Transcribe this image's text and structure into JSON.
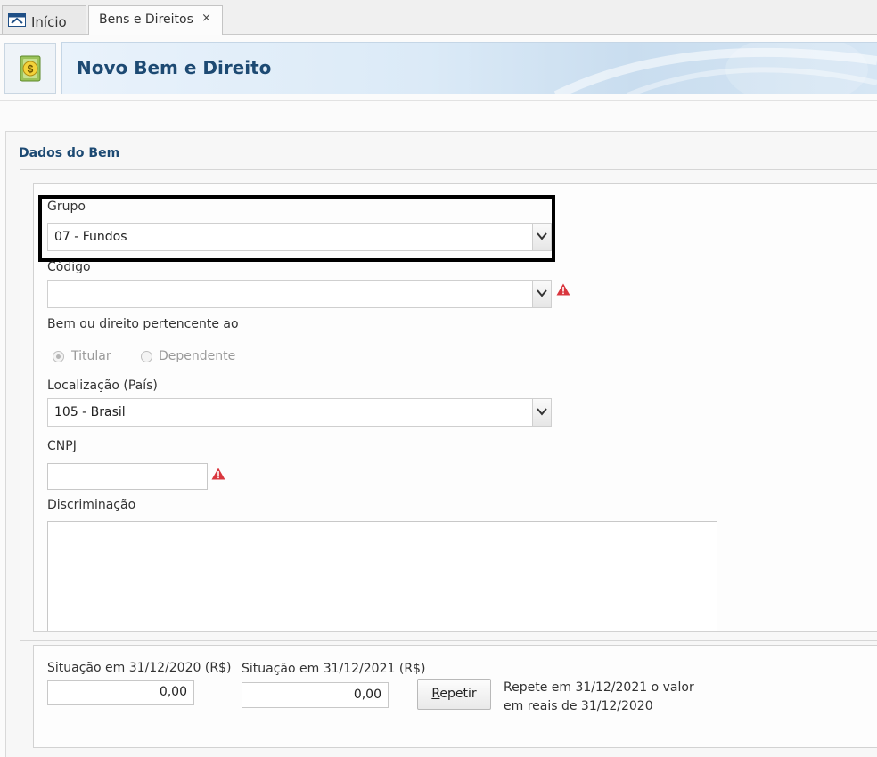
{
  "tabs": [
    {
      "label": "Início"
    },
    {
      "label": "Bens e Direitos",
      "close": "×"
    }
  ],
  "header": {
    "title": "Novo Bem e Direito"
  },
  "section": {
    "title": "Dados do Bem"
  },
  "form": {
    "grupo": {
      "label": "Grupo",
      "value": "07 - Fundos"
    },
    "codigo": {
      "label": "Código",
      "value": ""
    },
    "pertencente": {
      "label": "Bem ou direito pertencente ao",
      "options": [
        "Titular",
        "Dependente"
      ],
      "selected": "Titular"
    },
    "localizacao": {
      "label": "Localização (País)",
      "value": "105 - Brasil"
    },
    "cnpj": {
      "label": "CNPJ",
      "value": ""
    },
    "discriminacao": {
      "label": "Discriminação",
      "value": ""
    }
  },
  "values": {
    "sit2020": {
      "label": "Situação em 31/12/2020 (R$)",
      "value": "0,00"
    },
    "sit2021": {
      "label": "Situação em 31/12/2021 (R$)",
      "value": "0,00"
    },
    "repetir": {
      "label_first": "R",
      "label_rest": "epetir"
    },
    "hint_line1": "Repete em 31/12/2021 o valor",
    "hint_line2": "em reais de 31/12/2020"
  },
  "colors": {
    "title": "#1d4a73",
    "warning": "#d9363e"
  },
  "icons": [
    "home-icon",
    "money-icon",
    "chevron-down-icon",
    "warning-icon"
  ]
}
